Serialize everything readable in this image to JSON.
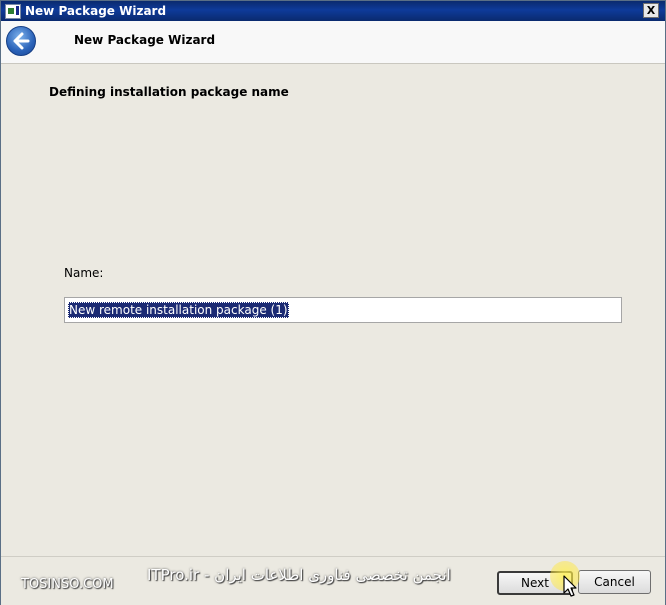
{
  "window": {
    "title": "New Package Wizard",
    "close_glyph": "X"
  },
  "header": {
    "back_icon": "back-arrow-icon",
    "title": "New Package Wizard"
  },
  "content": {
    "step_heading": "Defining installation package name",
    "name_label": "Name:",
    "name_value": "New remote installation package (1)"
  },
  "footer": {
    "next_label": "Next",
    "cancel_label": "Cancel"
  },
  "watermarks": {
    "left": "TOSINSO.COM",
    "right": "ITPro.ir - انجمن تخصصی فناوری اطلاعات ایران"
  },
  "colors": {
    "titlebar": "#0e3b9a",
    "selection": "#1b2a73",
    "back_button": "#2a62b8"
  }
}
